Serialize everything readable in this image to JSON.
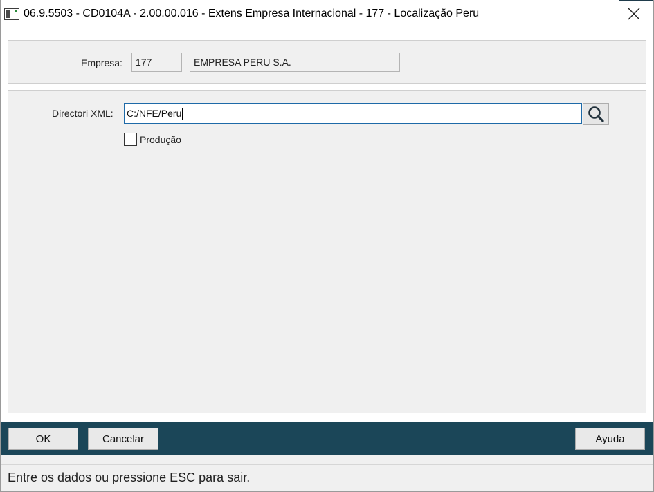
{
  "window": {
    "title": "06.9.5503 - CD0104A - 2.00.00.016 - Extens Empresa Internacional - 177 - Localização Peru"
  },
  "company": {
    "label": "Empresa:",
    "code": "177",
    "name": "EMPRESA PERU S.A."
  },
  "xml": {
    "label": "Directori XML:",
    "value": "C:/NFE/Peru"
  },
  "producao": {
    "label": "Produção",
    "checked": false
  },
  "buttons": {
    "ok": "OK",
    "cancel": "Cancelar",
    "help": "Ayuda"
  },
  "status": {
    "text": "Entre os dados ou pressione ESC para sair."
  },
  "icons": {
    "app": "app-window-icon",
    "close": "close-icon",
    "search": "search-icon"
  },
  "colors": {
    "footer_bg": "#1b4658",
    "active_border": "#1e6aa8"
  }
}
